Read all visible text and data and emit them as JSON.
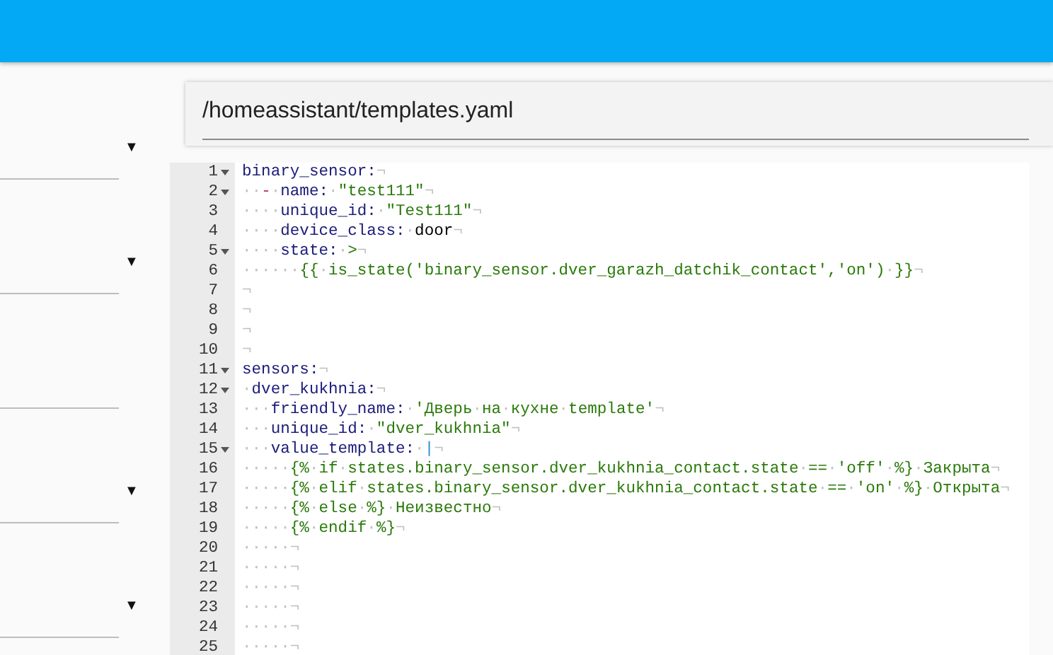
{
  "sidebar": {
    "sections": [
      {
        "kind": "dropdown",
        "toggle": "▼"
      },
      {
        "kind": "dropdown",
        "toggle": "▼"
      },
      {
        "kind": "blank"
      },
      {
        "kind": "dropdown",
        "toggle": "▼"
      },
      {
        "kind": "dropdown",
        "toggle": "▼"
      }
    ]
  },
  "editor": {
    "file_path": "/homeassistant/templates.yaml",
    "lines": [
      {
        "number": "1",
        "foldable": true,
        "tokens": [
          {
            "t": "binary_sensor:",
            "kind": "key"
          },
          {
            "t": "¬",
            "kind": "ws"
          }
        ]
      },
      {
        "number": "2",
        "foldable": true,
        "tokens": [
          {
            "t": "··",
            "kind": "ws"
          },
          {
            "t": "-",
            "kind": "dash"
          },
          {
            "t": "·",
            "kind": "ws"
          },
          {
            "t": "name:",
            "kind": "key"
          },
          {
            "t": "·",
            "kind": "ws"
          },
          {
            "t": "\"test111\"",
            "kind": "str"
          },
          {
            "t": "¬",
            "kind": "ws"
          }
        ]
      },
      {
        "number": "3",
        "foldable": false,
        "tokens": [
          {
            "t": "····",
            "kind": "ws"
          },
          {
            "t": "unique_id:",
            "kind": "key"
          },
          {
            "t": "·",
            "kind": "ws"
          },
          {
            "t": "\"Test111\"",
            "kind": "str"
          },
          {
            "t": "¬",
            "kind": "ws"
          }
        ]
      },
      {
        "number": "4",
        "foldable": false,
        "tokens": [
          {
            "t": "····",
            "kind": "ws"
          },
          {
            "t": "device_class:",
            "kind": "key"
          },
          {
            "t": "·",
            "kind": "ws"
          },
          {
            "t": "door",
            "kind": "plain"
          },
          {
            "t": "¬",
            "kind": "ws"
          }
        ]
      },
      {
        "number": "5",
        "foldable": true,
        "tokens": [
          {
            "t": "····",
            "kind": "ws"
          },
          {
            "t": "state:",
            "kind": "key"
          },
          {
            "t": "·",
            "kind": "ws"
          },
          {
            "t": ">",
            "kind": "str"
          },
          {
            "t": "¬",
            "kind": "ws"
          }
        ]
      },
      {
        "number": "6",
        "foldable": false,
        "tokens": [
          {
            "t": "······",
            "kind": "ws"
          },
          {
            "t": "{{",
            "kind": "str"
          },
          {
            "t": "·",
            "kind": "ws"
          },
          {
            "t": "is_state('binary_sensor.dver_garazh_datchik_contact','on')",
            "kind": "str"
          },
          {
            "t": "·",
            "kind": "ws"
          },
          {
            "t": "}}",
            "kind": "str"
          },
          {
            "t": "¬",
            "kind": "ws"
          }
        ]
      },
      {
        "number": "7",
        "foldable": false,
        "tokens": [
          {
            "t": "¬",
            "kind": "ws"
          }
        ]
      },
      {
        "number": "8",
        "foldable": false,
        "tokens": [
          {
            "t": "¬",
            "kind": "ws"
          }
        ]
      },
      {
        "number": "9",
        "foldable": false,
        "tokens": [
          {
            "t": "¬",
            "kind": "ws"
          }
        ]
      },
      {
        "number": "10",
        "foldable": false,
        "tokens": [
          {
            "t": "¬",
            "kind": "ws"
          }
        ]
      },
      {
        "number": "11",
        "foldable": true,
        "tokens": [
          {
            "t": "sensors:",
            "kind": "key"
          },
          {
            "t": "¬",
            "kind": "ws"
          }
        ]
      },
      {
        "number": "12",
        "foldable": true,
        "tokens": [
          {
            "t": "·",
            "kind": "ws"
          },
          {
            "t": "dver_kukhnia:",
            "kind": "key"
          },
          {
            "t": "¬",
            "kind": "ws"
          }
        ]
      },
      {
        "number": "13",
        "foldable": false,
        "tokens": [
          {
            "t": "···",
            "kind": "ws"
          },
          {
            "t": "friendly_name:",
            "kind": "key"
          },
          {
            "t": "·",
            "kind": "ws"
          },
          {
            "t": "'Дверь",
            "kind": "str"
          },
          {
            "t": "·",
            "kind": "ws"
          },
          {
            "t": "на",
            "kind": "str"
          },
          {
            "t": "·",
            "kind": "ws"
          },
          {
            "t": "кухне",
            "kind": "str"
          },
          {
            "t": "·",
            "kind": "ws"
          },
          {
            "t": "template'",
            "kind": "str"
          },
          {
            "t": "¬",
            "kind": "ws"
          }
        ]
      },
      {
        "number": "14",
        "foldable": false,
        "tokens": [
          {
            "t": "···",
            "kind": "ws"
          },
          {
            "t": "unique_id:",
            "kind": "key"
          },
          {
            "t": "·",
            "kind": "ws"
          },
          {
            "t": "\"dver_kukhnia\"",
            "kind": "str"
          },
          {
            "t": "¬",
            "kind": "ws"
          }
        ]
      },
      {
        "number": "15",
        "foldable": true,
        "tokens": [
          {
            "t": "···",
            "kind": "ws"
          },
          {
            "t": "value_template:",
            "kind": "key"
          },
          {
            "t": "·",
            "kind": "ws"
          },
          {
            "t": "|",
            "kind": "pipe"
          },
          {
            "t": "¬",
            "kind": "ws"
          }
        ]
      },
      {
        "number": "16",
        "foldable": false,
        "tokens": [
          {
            "t": "·····",
            "kind": "ws"
          },
          {
            "t": "{%",
            "kind": "str"
          },
          {
            "t": "·",
            "kind": "ws"
          },
          {
            "t": "if",
            "kind": "str"
          },
          {
            "t": "·",
            "kind": "ws"
          },
          {
            "t": "states.binary_sensor.dver_kukhnia_contact.state",
            "kind": "str"
          },
          {
            "t": "·",
            "kind": "ws"
          },
          {
            "t": "==",
            "kind": "str"
          },
          {
            "t": "·",
            "kind": "ws"
          },
          {
            "t": "'off'",
            "kind": "str"
          },
          {
            "t": "·",
            "kind": "ws"
          },
          {
            "t": "%}",
            "kind": "str"
          },
          {
            "t": "·",
            "kind": "ws"
          },
          {
            "t": "Закрыта",
            "kind": "str"
          },
          {
            "t": "¬",
            "kind": "ws"
          }
        ]
      },
      {
        "number": "17",
        "foldable": false,
        "tokens": [
          {
            "t": "·····",
            "kind": "ws"
          },
          {
            "t": "{%",
            "kind": "str"
          },
          {
            "t": "·",
            "kind": "ws"
          },
          {
            "t": "elif",
            "kind": "str"
          },
          {
            "t": "·",
            "kind": "ws"
          },
          {
            "t": "states.binary_sensor.dver_kukhnia_contact.state",
            "kind": "str"
          },
          {
            "t": "·",
            "kind": "ws"
          },
          {
            "t": "==",
            "kind": "str"
          },
          {
            "t": "·",
            "kind": "ws"
          },
          {
            "t": "'on'",
            "kind": "str"
          },
          {
            "t": "·",
            "kind": "ws"
          },
          {
            "t": "%}",
            "kind": "str"
          },
          {
            "t": "·",
            "kind": "ws"
          },
          {
            "t": "Открыта",
            "kind": "str"
          },
          {
            "t": "¬",
            "kind": "ws"
          }
        ]
      },
      {
        "number": "18",
        "foldable": false,
        "tokens": [
          {
            "t": "·····",
            "kind": "ws"
          },
          {
            "t": "{%",
            "kind": "str"
          },
          {
            "t": "·",
            "kind": "ws"
          },
          {
            "t": "else",
            "kind": "str"
          },
          {
            "t": "·",
            "kind": "ws"
          },
          {
            "t": "%}",
            "kind": "str"
          },
          {
            "t": "·",
            "kind": "ws"
          },
          {
            "t": "Неизвестно",
            "kind": "str"
          },
          {
            "t": "¬",
            "kind": "ws"
          }
        ]
      },
      {
        "number": "19",
        "foldable": false,
        "tokens": [
          {
            "t": "·····",
            "kind": "ws"
          },
          {
            "t": "{%",
            "kind": "str"
          },
          {
            "t": "·",
            "kind": "ws"
          },
          {
            "t": "endif",
            "kind": "str"
          },
          {
            "t": "·",
            "kind": "ws"
          },
          {
            "t": "%}",
            "kind": "str"
          },
          {
            "t": "¬",
            "kind": "ws"
          }
        ]
      },
      {
        "number": "20",
        "foldable": false,
        "tokens": [
          {
            "t": "·····¬",
            "kind": "ws"
          }
        ]
      },
      {
        "number": "21",
        "foldable": false,
        "tokens": [
          {
            "t": "·····¬",
            "kind": "ws"
          }
        ]
      },
      {
        "number": "22",
        "foldable": false,
        "tokens": [
          {
            "t": "·····¬",
            "kind": "ws"
          }
        ]
      },
      {
        "number": "23",
        "foldable": false,
        "tokens": [
          {
            "t": "·····¬",
            "kind": "ws"
          }
        ]
      },
      {
        "number": "24",
        "foldable": false,
        "tokens": [
          {
            "t": "·····¬",
            "kind": "ws"
          }
        ]
      },
      {
        "number": "25",
        "foldable": false,
        "tokens": [
          {
            "t": "·····¬",
            "kind": "ws"
          }
        ]
      }
    ]
  }
}
